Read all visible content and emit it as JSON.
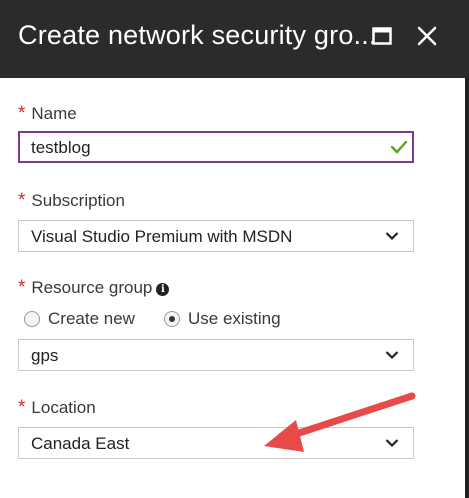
{
  "header": {
    "title": "Create network security gro...",
    "maximize_icon": "maximize-icon",
    "close_icon": "close-icon"
  },
  "form": {
    "required_marker": "*",
    "name": {
      "label": "Name",
      "value": "testblog",
      "valid_icon": "checkmark-icon"
    },
    "subscription": {
      "label": "Subscription",
      "value": "Visual Studio Premium with MSDN"
    },
    "resource_group": {
      "label": "Resource group",
      "info_icon": "info-icon",
      "options": [
        {
          "label": "Create new",
          "selected": false
        },
        {
          "label": "Use existing",
          "selected": true
        }
      ],
      "value": "gps"
    },
    "location": {
      "label": "Location",
      "value": "Canada East"
    }
  },
  "annotation": {
    "arrow_color": "#e84a4a"
  },
  "colors": {
    "header_bg": "#2b2b2b",
    "focus_border": "#7a3a96",
    "required": "#d42a2a",
    "valid_check": "#5aa51a"
  }
}
